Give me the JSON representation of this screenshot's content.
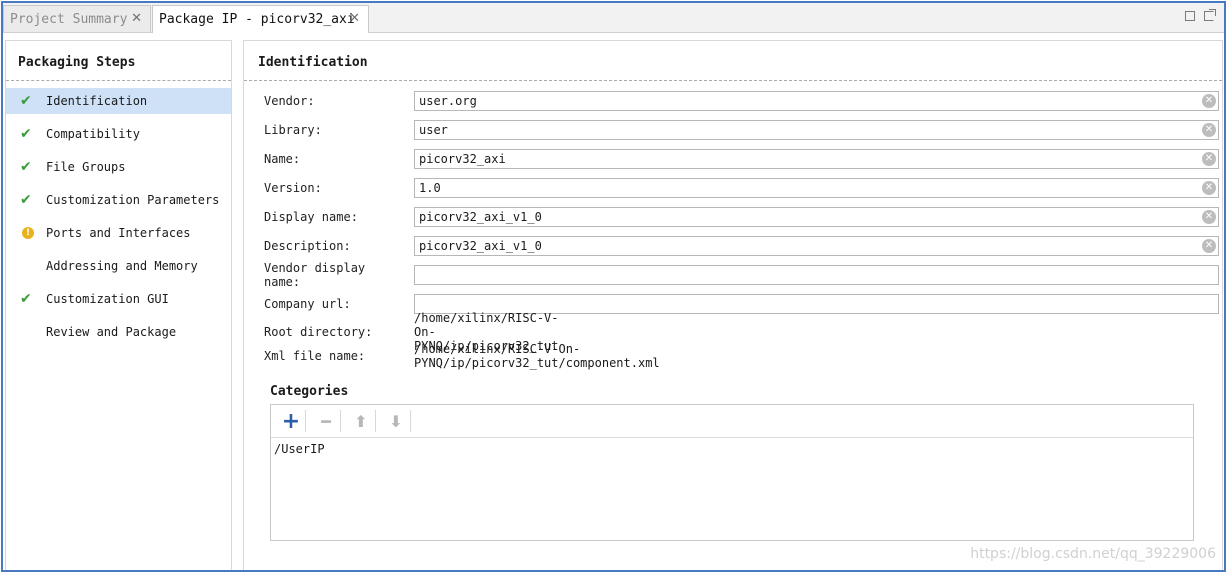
{
  "tabs": [
    {
      "label": "Project Summary",
      "active": false
    },
    {
      "label": "Package IP - picorv32_axi",
      "active": true
    }
  ],
  "steps_panel": {
    "title": "Packaging Steps",
    "items": [
      {
        "label": "Identification",
        "status": "check",
        "selected": true
      },
      {
        "label": "Compatibility",
        "status": "check"
      },
      {
        "label": "File Groups",
        "status": "check"
      },
      {
        "label": "Customization Parameters",
        "status": "check"
      },
      {
        "label": "Ports and Interfaces",
        "status": "warning"
      },
      {
        "label": "Addressing and Memory",
        "status": "none"
      },
      {
        "label": "Customization GUI",
        "status": "check"
      },
      {
        "label": "Review and Package",
        "status": "none"
      }
    ]
  },
  "identification": {
    "title": "Identification",
    "fields": [
      {
        "label": "Vendor:",
        "value": "user.org"
      },
      {
        "label": "Library:",
        "value": "user"
      },
      {
        "label": "Name:",
        "value": "picorv32_axi"
      },
      {
        "label": "Version:",
        "value": "1.0"
      },
      {
        "label": "Display name:",
        "value": "picorv32_axi_v1_0"
      },
      {
        "label": "Description:",
        "value": "picorv32_axi_v1_0"
      },
      {
        "label": "Vendor display name:",
        "value": ""
      },
      {
        "label": "Company url:",
        "value": ""
      }
    ],
    "root_directory_label": "Root directory:",
    "root_directory_value": "/home/xilinx/RISC-V-On-PYNQ/ip/picorv32_tut",
    "xml_file_label": "Xml file name:",
    "xml_file_value": "/home/xilinx/RISC-V-On-PYNQ/ip/picorv32_tut/component.xml"
  },
  "categories": {
    "title": "Categories",
    "items": [
      "/UserIP"
    ]
  },
  "watermark": "https://blog.csdn.net/qq_39229006",
  "colors": {
    "frame": "#4a79c4",
    "selected": "#cfe1f7",
    "check": "#3a9b3a",
    "warning": "#e8b21c",
    "add": "#2b5fa8"
  }
}
